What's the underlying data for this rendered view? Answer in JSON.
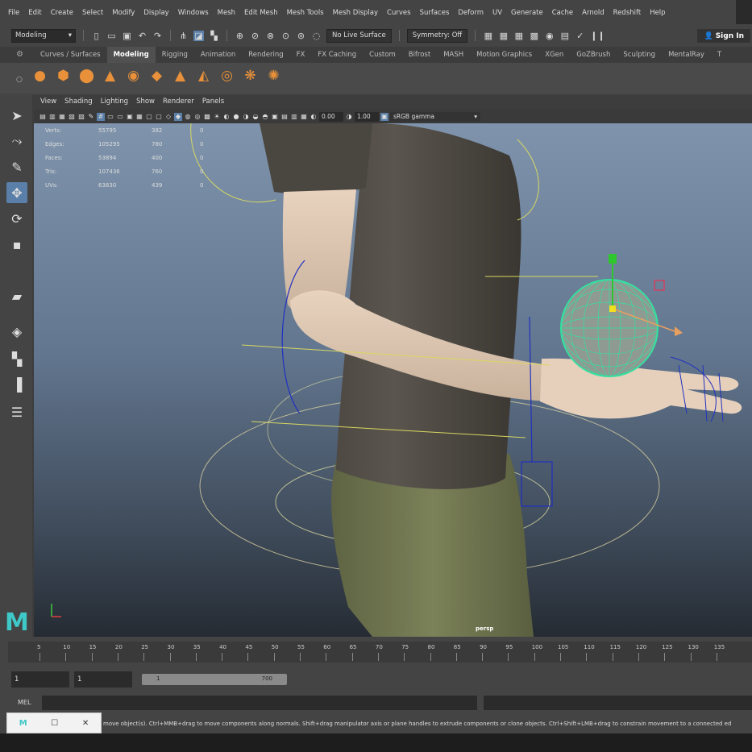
{
  "menu": [
    "File",
    "Edit",
    "Create",
    "Select",
    "Modify",
    "Display",
    "Windows",
    "Mesh",
    "Edit Mesh",
    "Mesh Tools",
    "Mesh Display",
    "Curves",
    "Surfaces",
    "Deform",
    "UV",
    "Generate",
    "Cache",
    "Arnold",
    "Redshift",
    "Help"
  ],
  "status_line": {
    "mode": "Modeling",
    "live_surface": "No Live Surface",
    "symmetry": "Symmetry: Off",
    "sign_in": "Sign In"
  },
  "shelf": {
    "tabs": [
      "Curves / Surfaces",
      "Modeling",
      "Rigging",
      "Animation",
      "Rendering",
      "FX",
      "FX Caching",
      "Custom",
      "Bifrost",
      "MASH",
      "Motion Graphics",
      "XGen",
      "GoZBrush",
      "Sculpting",
      "MentalRay",
      "T"
    ],
    "active_tab": "Modeling",
    "icons": [
      "sphere-icon",
      "cube-icon",
      "cylinder-icon",
      "cone-icon",
      "torus-icon",
      "plane-icon",
      "pyramid-icon",
      "prism-icon",
      "pipe-icon",
      "helix-icon",
      "soccer-ball-icon"
    ],
    "icon_color": "#e8913a"
  },
  "panel_menu": [
    "View",
    "Shading",
    "Lighting",
    "Show",
    "Renderer",
    "Panels"
  ],
  "panel_toolbar": {
    "exposure": "0.00",
    "gamma": "1.00",
    "color_space": "sRGB gamma"
  },
  "hud": {
    "rows": [
      {
        "label": "Verts:",
        "a": "55795",
        "b": "382",
        "c": "0"
      },
      {
        "label": "Edges:",
        "a": "105295",
        "b": "780",
        "c": "0"
      },
      {
        "label": "Faces:",
        "a": "53894",
        "b": "400",
        "c": "0"
      },
      {
        "label": "Tris:",
        "a": "107436",
        "b": "760",
        "c": "0"
      },
      {
        "label": "UVs:",
        "a": "63830",
        "b": "439",
        "c": "0"
      }
    ]
  },
  "camera_label": "persp",
  "timeline": {
    "ticks": [
      "5",
      "10",
      "15",
      "20",
      "25",
      "30",
      "35",
      "40",
      "45",
      "50",
      "55",
      "60",
      "65",
      "70",
      "75",
      "80",
      "85",
      "90",
      "95",
      "100",
      "105",
      "110",
      "115",
      "120",
      "125",
      "130",
      "135"
    ]
  },
  "range": {
    "start": "1",
    "playback_start": "1",
    "range_start_label": "1",
    "range_end_label": "700"
  },
  "command_line": {
    "language": "MEL",
    "help_text": "move object(s). Ctrl+MMB+drag to move components along normals. Shift+drag manipulator axis or plane handles to extrude components or clone objects. Ctrl+Shift+LMB+drag to constrain movement to a connected ed"
  },
  "taskbar_window": {
    "app": "M",
    "restore": "☐",
    "close": "✕"
  },
  "colors": {
    "accent": "#5a7fa8",
    "selection_green": "#35e0a0",
    "maya_logo": "#3fc8c8"
  }
}
